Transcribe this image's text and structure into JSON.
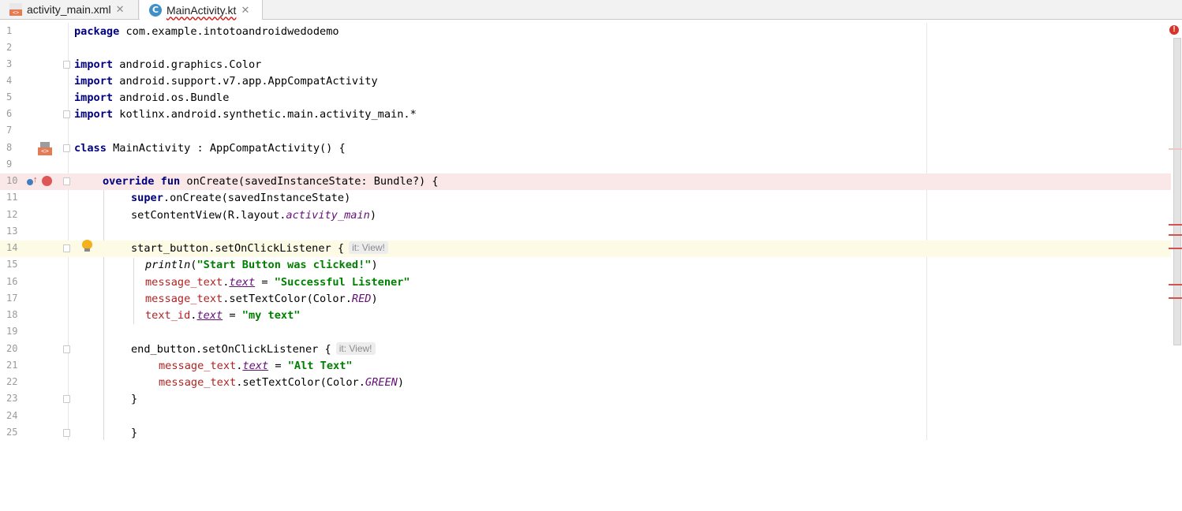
{
  "tabs": [
    {
      "label": "activity_main.xml",
      "icon": "xml-file-icon",
      "active": false
    },
    {
      "label": "MainActivity.kt",
      "icon": "kotlin-class-file-icon",
      "active": true
    }
  ],
  "close_glyph": "✕",
  "hints": {
    "line14": "it: View!",
    "line20": "it: View!"
  },
  "lines": {
    "1": {
      "num": "1",
      "kw": "package",
      "rest": " com.example.intotoandroidwedodemo"
    },
    "2": {
      "num": "2"
    },
    "3": {
      "num": "3",
      "kw": "import",
      "rest": " android.graphics.Color"
    },
    "4": {
      "num": "4",
      "kw": "import",
      "rest": " android.support.v7.app.AppCompatActivity"
    },
    "5": {
      "num": "5",
      "kw": "import",
      "rest": " android.os.Bundle"
    },
    "6": {
      "num": "6",
      "kw": "import",
      "rest": " kotlinx.android.synthetic.main.activity_main.*"
    },
    "7": {
      "num": "7"
    },
    "8": {
      "num": "8",
      "kw": "class",
      "rest": " MainActivity : AppCompatActivity() {"
    },
    "9": {
      "num": "9"
    },
    "10": {
      "num": "10",
      "kw": "override fun",
      "rest": " onCreate(savedInstanceState: Bundle?) {"
    },
    "11": {
      "num": "11",
      "kw": "super",
      "rest": ".onCreate(savedInstanceState)"
    },
    "12": {
      "num": "12",
      "pre": "setContentView(R.layout.",
      "it": "activity_main",
      "post": ")"
    },
    "13": {
      "num": "13"
    },
    "14": {
      "num": "14",
      "pre": "start_button.setOnClickListener {"
    },
    "15": {
      "num": "15",
      "it": "println",
      "pre": "(",
      "str": "\"Start Button was clicked!\"",
      "post": ")"
    },
    "16": {
      "num": "16",
      "fld": "message_text",
      "dot": ".",
      "itu": "text",
      "eq": " = ",
      "str": "\"Successful Listener\""
    },
    "17": {
      "num": "17",
      "fld": "message_text",
      "pre": ".setTextColor(Color.",
      "it": "RED",
      "post": ")"
    },
    "18": {
      "num": "18",
      "fld": "text_id",
      "dot": ".",
      "itu": "text",
      "eq": " = ",
      "str": "\"my text\""
    },
    "19": {
      "num": "19"
    },
    "20": {
      "num": "20",
      "pre": "end_button.setOnClickListener {"
    },
    "21": {
      "num": "21",
      "fld": "message_text",
      "dot": ".",
      "itu": "text",
      "eq": " = ",
      "str": "\"Alt Text\""
    },
    "22": {
      "num": "22",
      "fld": "message_text",
      "pre": ".setTextColor(Color.",
      "it": "GREEN",
      "post": ")"
    },
    "23": {
      "num": "23",
      "pre": "}"
    },
    "24": {
      "num": "24"
    },
    "25": {
      "num": "25",
      "pre": "}"
    }
  },
  "gutter_icons": {
    "line8": "class-layout-icon",
    "line10_override": "override-method-icon",
    "line10_bp": "breakpoint-icon",
    "line14": "lightbulb-icon"
  },
  "error_indicator": "!",
  "colors": {
    "keyword": "#000080",
    "string": "#008000",
    "field": "#b22222",
    "italic": "#660e7a",
    "breakpoint_line": "#fae8e8",
    "current_line": "#fdfae6"
  }
}
